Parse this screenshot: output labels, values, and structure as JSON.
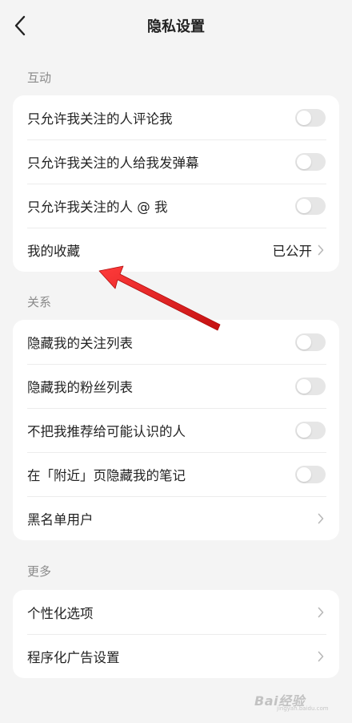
{
  "header": {
    "title": "隐私设置",
    "back_icon": "chevron-left-icon"
  },
  "sections": {
    "interaction": {
      "label": "互动",
      "items": [
        {
          "label": "只允许我关注的人评论我",
          "toggle_on": false
        },
        {
          "label": "只允许我关注的人给我发弹幕",
          "toggle_on": false
        },
        {
          "label": "只允许我关注的人 @ 我",
          "toggle_on": false
        },
        {
          "label": "我的收藏",
          "value": "已公开"
        }
      ]
    },
    "relations": {
      "label": "关系",
      "items": [
        {
          "label": "隐藏我的关注列表",
          "toggle_on": false
        },
        {
          "label": "隐藏我的粉丝列表",
          "toggle_on": false
        },
        {
          "label": "不把我推荐给可能认识的人",
          "toggle_on": false
        },
        {
          "label": "在「附近」页隐藏我的笔记",
          "toggle_on": false
        },
        {
          "label": "黑名单用户"
        }
      ]
    },
    "more": {
      "label": "更多",
      "items": [
        {
          "label": "个性化选项"
        },
        {
          "label": "程序化广告设置"
        }
      ]
    }
  },
  "colors": {
    "background": "#f4f4f4",
    "card": "#ffffff",
    "toggle_off": "#e6e6e6",
    "section_label": "#8a8a8a",
    "annotation_arrow": "#e02020"
  },
  "watermark": {
    "text": "Bai经验",
    "sub": "jingyan.baidu.com"
  }
}
